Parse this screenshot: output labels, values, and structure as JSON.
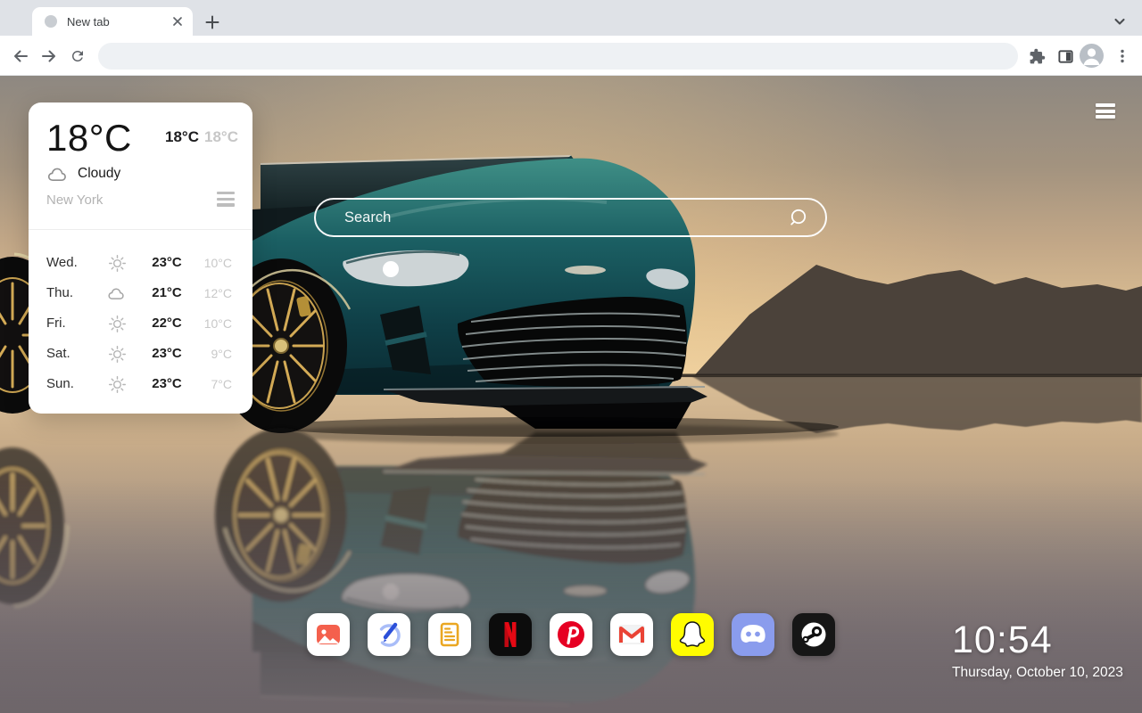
{
  "browser": {
    "tab_title": "New tab",
    "address_value": ""
  },
  "weather": {
    "temp": "18°C",
    "high": "18°C",
    "low": "18°C",
    "condition": "Cloudy",
    "city": "New York",
    "forecast": [
      {
        "day": "Wed.",
        "icon": "sun",
        "high": "23°C",
        "low": "10°C"
      },
      {
        "day": "Thu.",
        "icon": "cloud",
        "high": "21°C",
        "low": "12°C"
      },
      {
        "day": "Fri.",
        "icon": "sun",
        "high": "22°C",
        "low": "10°C"
      },
      {
        "day": "Sat.",
        "icon": "sun",
        "high": "23°C",
        "low": "9°C"
      },
      {
        "day": "Sun.",
        "icon": "sun",
        "high": "23°C",
        "low": "7°C"
      }
    ]
  },
  "search": {
    "placeholder": "Search"
  },
  "clock": {
    "time": "10:54",
    "date": "Thursday, October 10, 2023"
  },
  "dock": [
    {
      "name": "wallpaper"
    },
    {
      "name": "editor"
    },
    {
      "name": "notes"
    },
    {
      "name": "netflix"
    },
    {
      "name": "pinterest"
    },
    {
      "name": "gmail"
    },
    {
      "name": "snapchat"
    },
    {
      "name": "discord"
    },
    {
      "name": "steam"
    }
  ],
  "colors": {
    "netflix_red": "#e50914",
    "pinterest_red": "#e60023",
    "snapchat_yellow": "#fffc00",
    "discord_blurple": "#8a9ced",
    "gmail_red": "#ea4335",
    "wallpaper_coral": "#f4604d",
    "editor_blue": "#2b50d9",
    "notes_gold": "#eaa722",
    "car_teal": "#17525a",
    "search_border": "#ffffff"
  }
}
